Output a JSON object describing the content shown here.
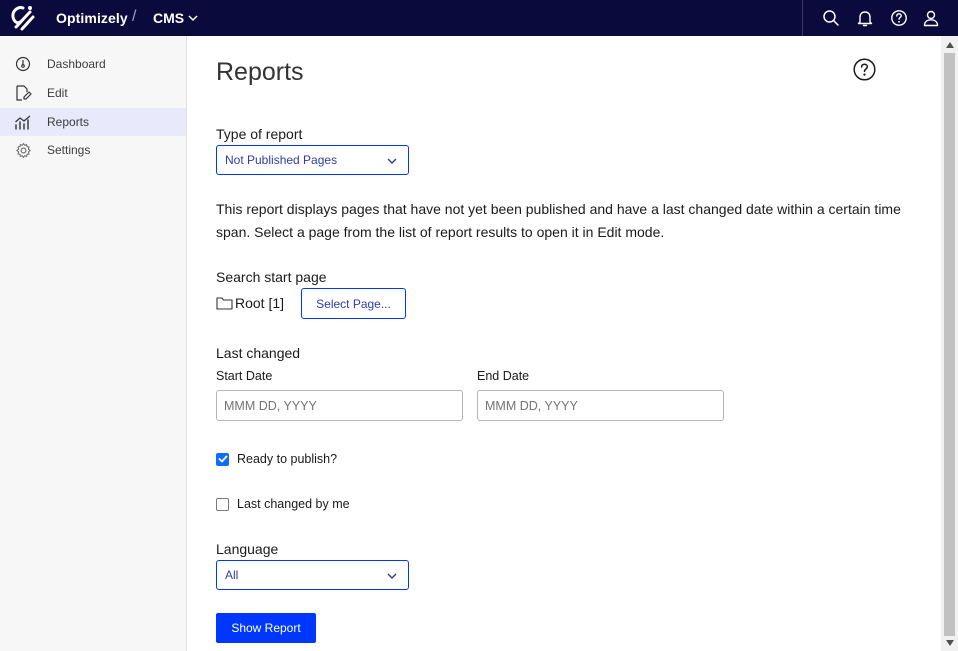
{
  "header": {
    "brand": "Optimizely",
    "separator": "/",
    "product": "CMS",
    "icons": [
      "search-icon",
      "bell-icon",
      "help-icon",
      "user-icon"
    ],
    "background": "#0b0a3d"
  },
  "sidebar": {
    "items": [
      {
        "label": "Dashboard",
        "icon": "dashboard-icon",
        "active": false
      },
      {
        "label": "Edit",
        "icon": "edit-icon",
        "active": false
      },
      {
        "label": "Reports",
        "icon": "reports-icon",
        "active": true
      },
      {
        "label": "Settings",
        "icon": "settings-icon",
        "active": false
      }
    ]
  },
  "main": {
    "title": "Reports",
    "report_type": {
      "label": "Type of report",
      "value": "Not Published Pages"
    },
    "description": "This report displays pages that have not yet been published and have a last changed date within a certain time span. Select a page from the list of report results to open it in Edit mode.",
    "start_page": {
      "label": "Search start page",
      "value": "Root [1]",
      "button": "Select Page..."
    },
    "last_changed": {
      "label": "Last changed",
      "start_label": "Start Date",
      "start_placeholder": "MMM DD, YYYY",
      "end_label": "End Date",
      "end_placeholder": "MMM DD, YYYY"
    },
    "ready_to_publish": {
      "label": "Ready to publish?",
      "checked": true
    },
    "changed_by_me": {
      "label": "Last changed by me",
      "checked": false
    },
    "language": {
      "label": "Language",
      "value": "All"
    },
    "show_report": "Show Report"
  },
  "colors": {
    "accent": "#0037ff",
    "active_nav": "#e8e9fb",
    "checkbox": "#0d6efd"
  }
}
